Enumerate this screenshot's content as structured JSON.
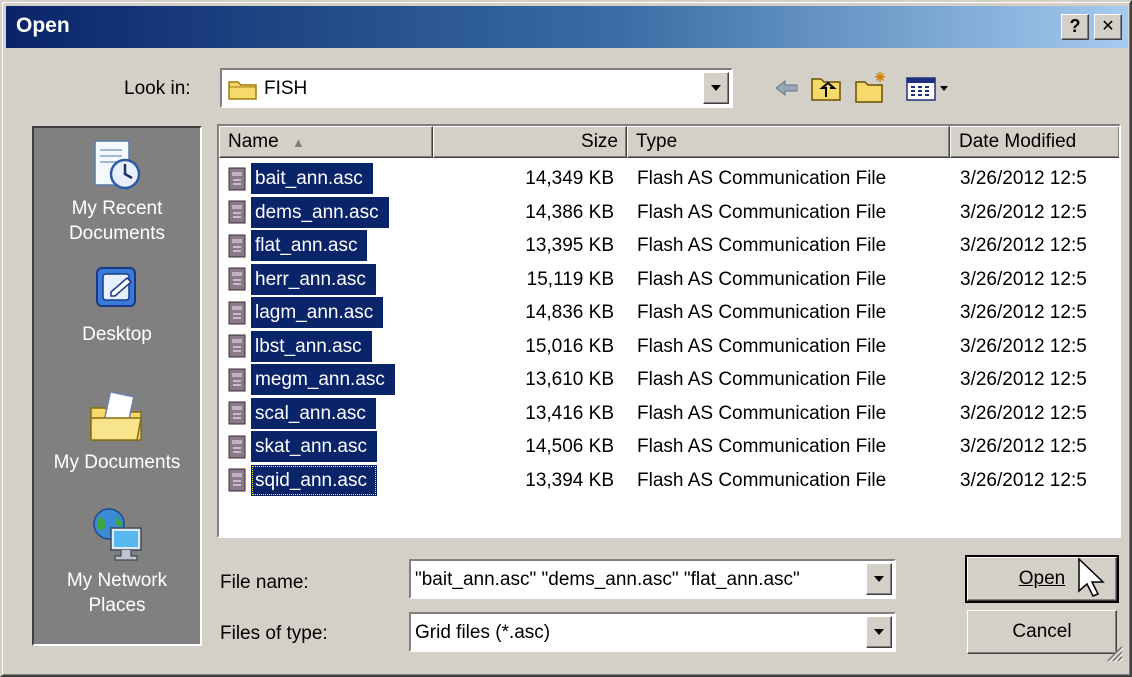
{
  "window": {
    "title": "Open",
    "help_label": "?",
    "close_label": "✕"
  },
  "lookin": {
    "label": "Look in:",
    "value": "FISH"
  },
  "toolbar": {
    "icons": [
      "back-arrow-icon",
      "up-folder-icon",
      "new-folder-icon",
      "view-menu-icon"
    ]
  },
  "places": [
    {
      "label": "My Recent Documents",
      "line1": "My Recent",
      "line2": "Documents",
      "icon": "recent-documents-icon"
    },
    {
      "label": "Desktop",
      "line1": "Desktop",
      "line2": "",
      "icon": "desktop-icon"
    },
    {
      "label": "My Documents",
      "line1": "My Documents",
      "line2": "",
      "icon": "my-documents-icon"
    },
    {
      "label": "My Network Places",
      "line1": "My Network",
      "line2": "Places",
      "icon": "network-places-icon"
    }
  ],
  "columns": {
    "name": "Name",
    "size": "Size",
    "type": "Type",
    "date": "Date Modified"
  },
  "files": [
    {
      "name": "bait_ann.asc",
      "size": "14,349 KB",
      "type": "Flash AS Communication File",
      "date": "3/26/2012 12:5"
    },
    {
      "name": "dems_ann.asc",
      "size": "14,386 KB",
      "type": "Flash AS Communication File",
      "date": "3/26/2012 12:5"
    },
    {
      "name": "flat_ann.asc",
      "size": "13,395 KB",
      "type": "Flash AS Communication File",
      "date": "3/26/2012 12:5"
    },
    {
      "name": "herr_ann.asc",
      "size": "15,119 KB",
      "type": "Flash AS Communication File",
      "date": "3/26/2012 12:5"
    },
    {
      "name": "lagm_ann.asc",
      "size": "14,836 KB",
      "type": "Flash AS Communication File",
      "date": "3/26/2012 12:5"
    },
    {
      "name": "lbst_ann.asc",
      "size": "15,016 KB",
      "type": "Flash AS Communication File",
      "date": "3/26/2012 12:5"
    },
    {
      "name": "megm_ann.asc",
      "size": "13,610 KB",
      "type": "Flash AS Communication File",
      "date": "3/26/2012 12:5"
    },
    {
      "name": "scal_ann.asc",
      "size": "13,416 KB",
      "type": "Flash AS Communication File",
      "date": "3/26/2012 12:5"
    },
    {
      "name": "skat_ann.asc",
      "size": "14,506 KB",
      "type": "Flash AS Communication File",
      "date": "3/26/2012 12:5"
    },
    {
      "name": "sqid_ann.asc",
      "size": "13,394 KB",
      "type": "Flash AS Communication File",
      "date": "3/26/2012 12:5"
    }
  ],
  "filename": {
    "label": "File name:",
    "value": "\"bait_ann.asc\" \"dems_ann.asc\" \"flat_ann.asc\""
  },
  "filetype": {
    "label": "Files of type:",
    "value": "Grid files (*.asc)"
  },
  "buttons": {
    "open": "Open",
    "cancel": "Cancel"
  },
  "colors": {
    "titlebar": "#0a246a",
    "selection": "#0a246a",
    "face": "#d4d0c8",
    "places_bg": "#808080"
  }
}
